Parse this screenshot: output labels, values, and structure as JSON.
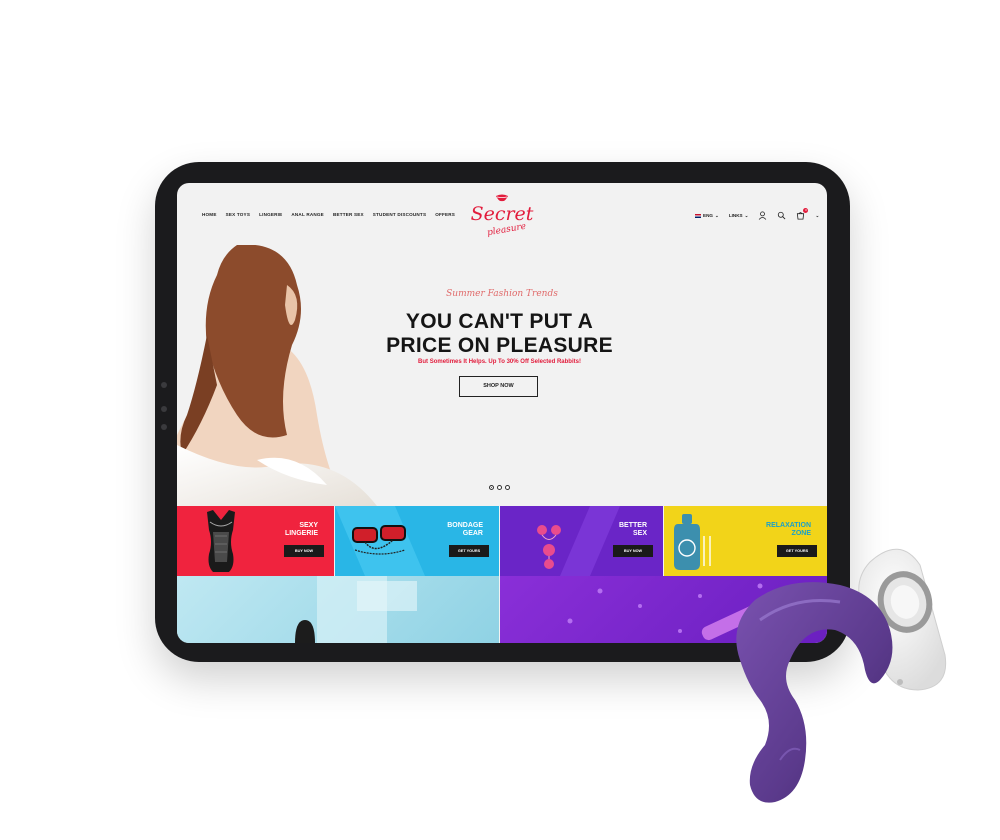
{
  "nav": {
    "menu": [
      "HOME",
      "SEX TOYS",
      "LINGERIE",
      "ANAL RANGE",
      "BETTER SEX",
      "STUDENT DISCOUNTS",
      "OFFERS"
    ],
    "language": "ENG",
    "links": "LINKS",
    "cart_count": "0"
  },
  "logo": {
    "line1": "Secret",
    "line2": "pleasure"
  },
  "hero": {
    "tagline": "Summer Fashion Trends",
    "title_line1": "YOU CAN'T PUT A",
    "title_line2": "PRICE ON PLEASURE",
    "subtitle": "But Sometimes It Helps. Up To 30% Off Selected Rabbits!",
    "button": "SHOP NOW",
    "slides": 3,
    "active_slide": 1
  },
  "tiles": [
    {
      "line1": "SEXY",
      "line2": "LINGERIE",
      "button": "BUY NOW",
      "color": "#f0233e"
    },
    {
      "line1": "BONDAGE",
      "line2": "GEAR",
      "button": "GET YOURS",
      "color": "#29b6e6"
    },
    {
      "line1": "BETTER",
      "line2": "SEX",
      "button": "BUY NOW",
      "color": "#6a25c7"
    },
    {
      "line1": "RELAXATION",
      "line2": "ZONE",
      "button": "GET YOURS",
      "color": "#f2d419"
    }
  ],
  "colors": {
    "accent": "#e21c3c",
    "frame": "#1b1b1d",
    "toy": "#5b3a8c"
  }
}
